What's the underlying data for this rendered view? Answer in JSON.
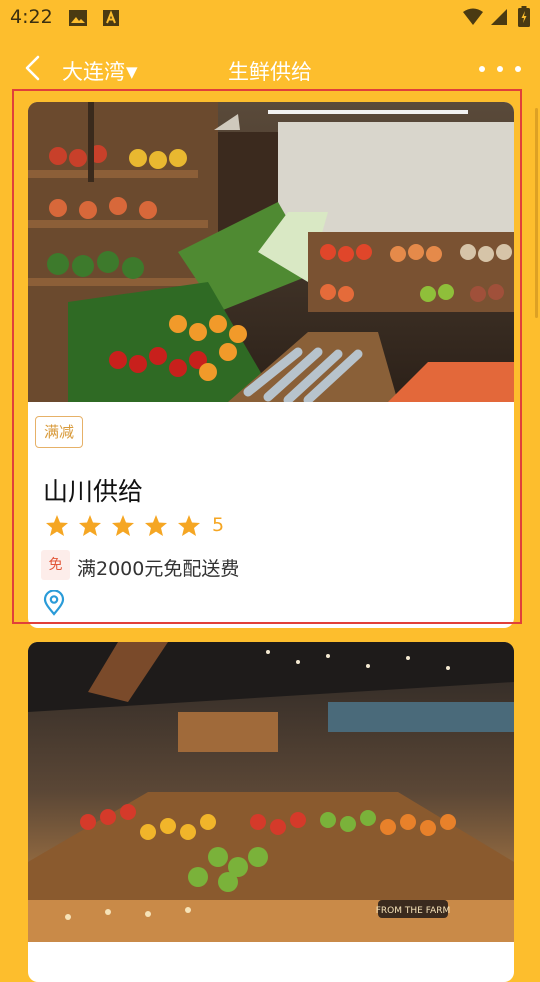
{
  "status_bar": {
    "time": "4:22",
    "icons": [
      "image-icon",
      "a-icon",
      "wifi-icon",
      "signal-icon",
      "battery-icon"
    ]
  },
  "nav": {
    "location": "大连湾",
    "location_caret": "▼",
    "title": "生鲜供给"
  },
  "cards": [
    {
      "tag": "满减",
      "name": "山川供给",
      "rating": 5,
      "rating_text": "5",
      "free_badge": "免",
      "delivery": "满2000元免配送费",
      "image": "produce-market-photo"
    },
    {
      "image": "supermarket-interior-photo",
      "overlay_sign": "FROM THE FARM"
    }
  ],
  "colors": {
    "background": "#FDBE2D",
    "star": "#F5A623",
    "tag_border": "#E6B168",
    "highlight": "#E0403A",
    "pin": "#2A9BD8"
  }
}
